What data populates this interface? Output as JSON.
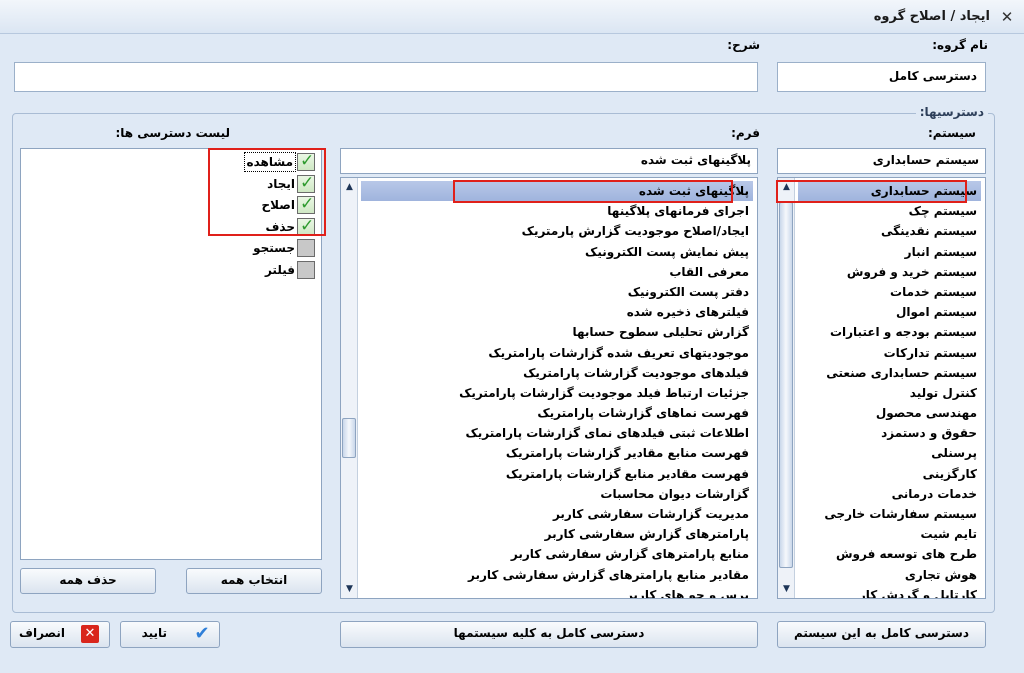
{
  "window": {
    "title": "ایجاد / اصلاح گروه",
    "close_glyph": "✕"
  },
  "form": {
    "group_name_label": "نام گروه:",
    "group_name_value": "دسترسی کامل",
    "description_label": "شرح:",
    "description_value": ""
  },
  "access": {
    "legend": "دسترسیها:",
    "system_label": "سیستم:",
    "system_selected": "سیستم حسابداری",
    "systems": [
      "سیستم حسابداری",
      "سیستم چک",
      "سیستم نقدینگی",
      "سیستم انبار",
      "سیستم خرید و فروش",
      "سیستم خدمات",
      "سیستم اموال",
      "سیستم بودجه و اعتبارات",
      "سیستم تدارکات",
      "سیستم حسابداری صنعتی",
      "کنترل تولید",
      "مهندسی محصول",
      "حقوق و دستمزد",
      "پرسنلی",
      "کارگزینی",
      "خدمات درمانی",
      "سیستم سفارشات خارجی",
      "تایم شیت",
      "طرح های توسعه فروش",
      "هوش تجاری",
      "کارتابل و گردش کار"
    ],
    "form_label": "فرم:",
    "form_selected": "پلاگینهای ثبت شده",
    "forms": [
      "پلاگینهای ثبت شده",
      "اجرای فرمانهای پلاگینها",
      "ایجاد/اصلاح موجودیت گزارش پارمتریک",
      "پیش نمایش پست الکترونیک",
      "معرفی القاب",
      "دفتر پست الکترونیک",
      "فیلترهای ذخیره شده",
      "گزارش تحلیلی سطوح حسابها",
      "موجودیتهای تعریف شده گزارشات پارامتریک",
      "فیلدهای موجودیت گزارشات پارامتریک",
      "جزئیات ارتباط فیلد موجودیت گزارشات پارامتریک",
      "فهرست نماهای گزارشات پارامتریک",
      "اطلاعات ثبتی فیلدهای نمای گزارشات پارامتریک",
      "فهرست منابع مقادیر گزارشات پارامتریک",
      "فهرست مقادیر منابع گزارشات پارامتریک",
      "گزارشات دیوان محاسبات",
      "مدیریت گزارشات سفارشی کاربر",
      "پارامترهای گزارش سفارشی کاربر",
      "منابع پارامترهای گزارش سفارشی کاربر",
      "مقادیر منابع پارامترهای گزارش سفارشی کاربر",
      "پرس و جو های کاربر"
    ],
    "permissions_label": "لیست دسترسی ها:",
    "permissions": [
      {
        "label": "مشاهده",
        "checked": true
      },
      {
        "label": "ایجاد",
        "checked": true
      },
      {
        "label": "اصلاح",
        "checked": true
      },
      {
        "label": "حذف",
        "checked": true
      },
      {
        "label": "جستجو",
        "checked": false
      },
      {
        "label": "فیلتر",
        "checked": false
      }
    ],
    "select_all_label": "انتخاب همه",
    "delete_all_label": "حذف همه"
  },
  "buttons": {
    "full_access_system": "دسترسی کامل به این سیستم",
    "full_access_all": "دسترسی کامل به کلیه سیستمها",
    "confirm": "تایید",
    "cancel": "انصراف"
  },
  "colors": {
    "highlight": "#e0201a",
    "selection": "#a9bce2",
    "check": "#2e9a2e",
    "cancel_icon": "#d9261c",
    "confirm_icon": "#2f7fd8"
  }
}
